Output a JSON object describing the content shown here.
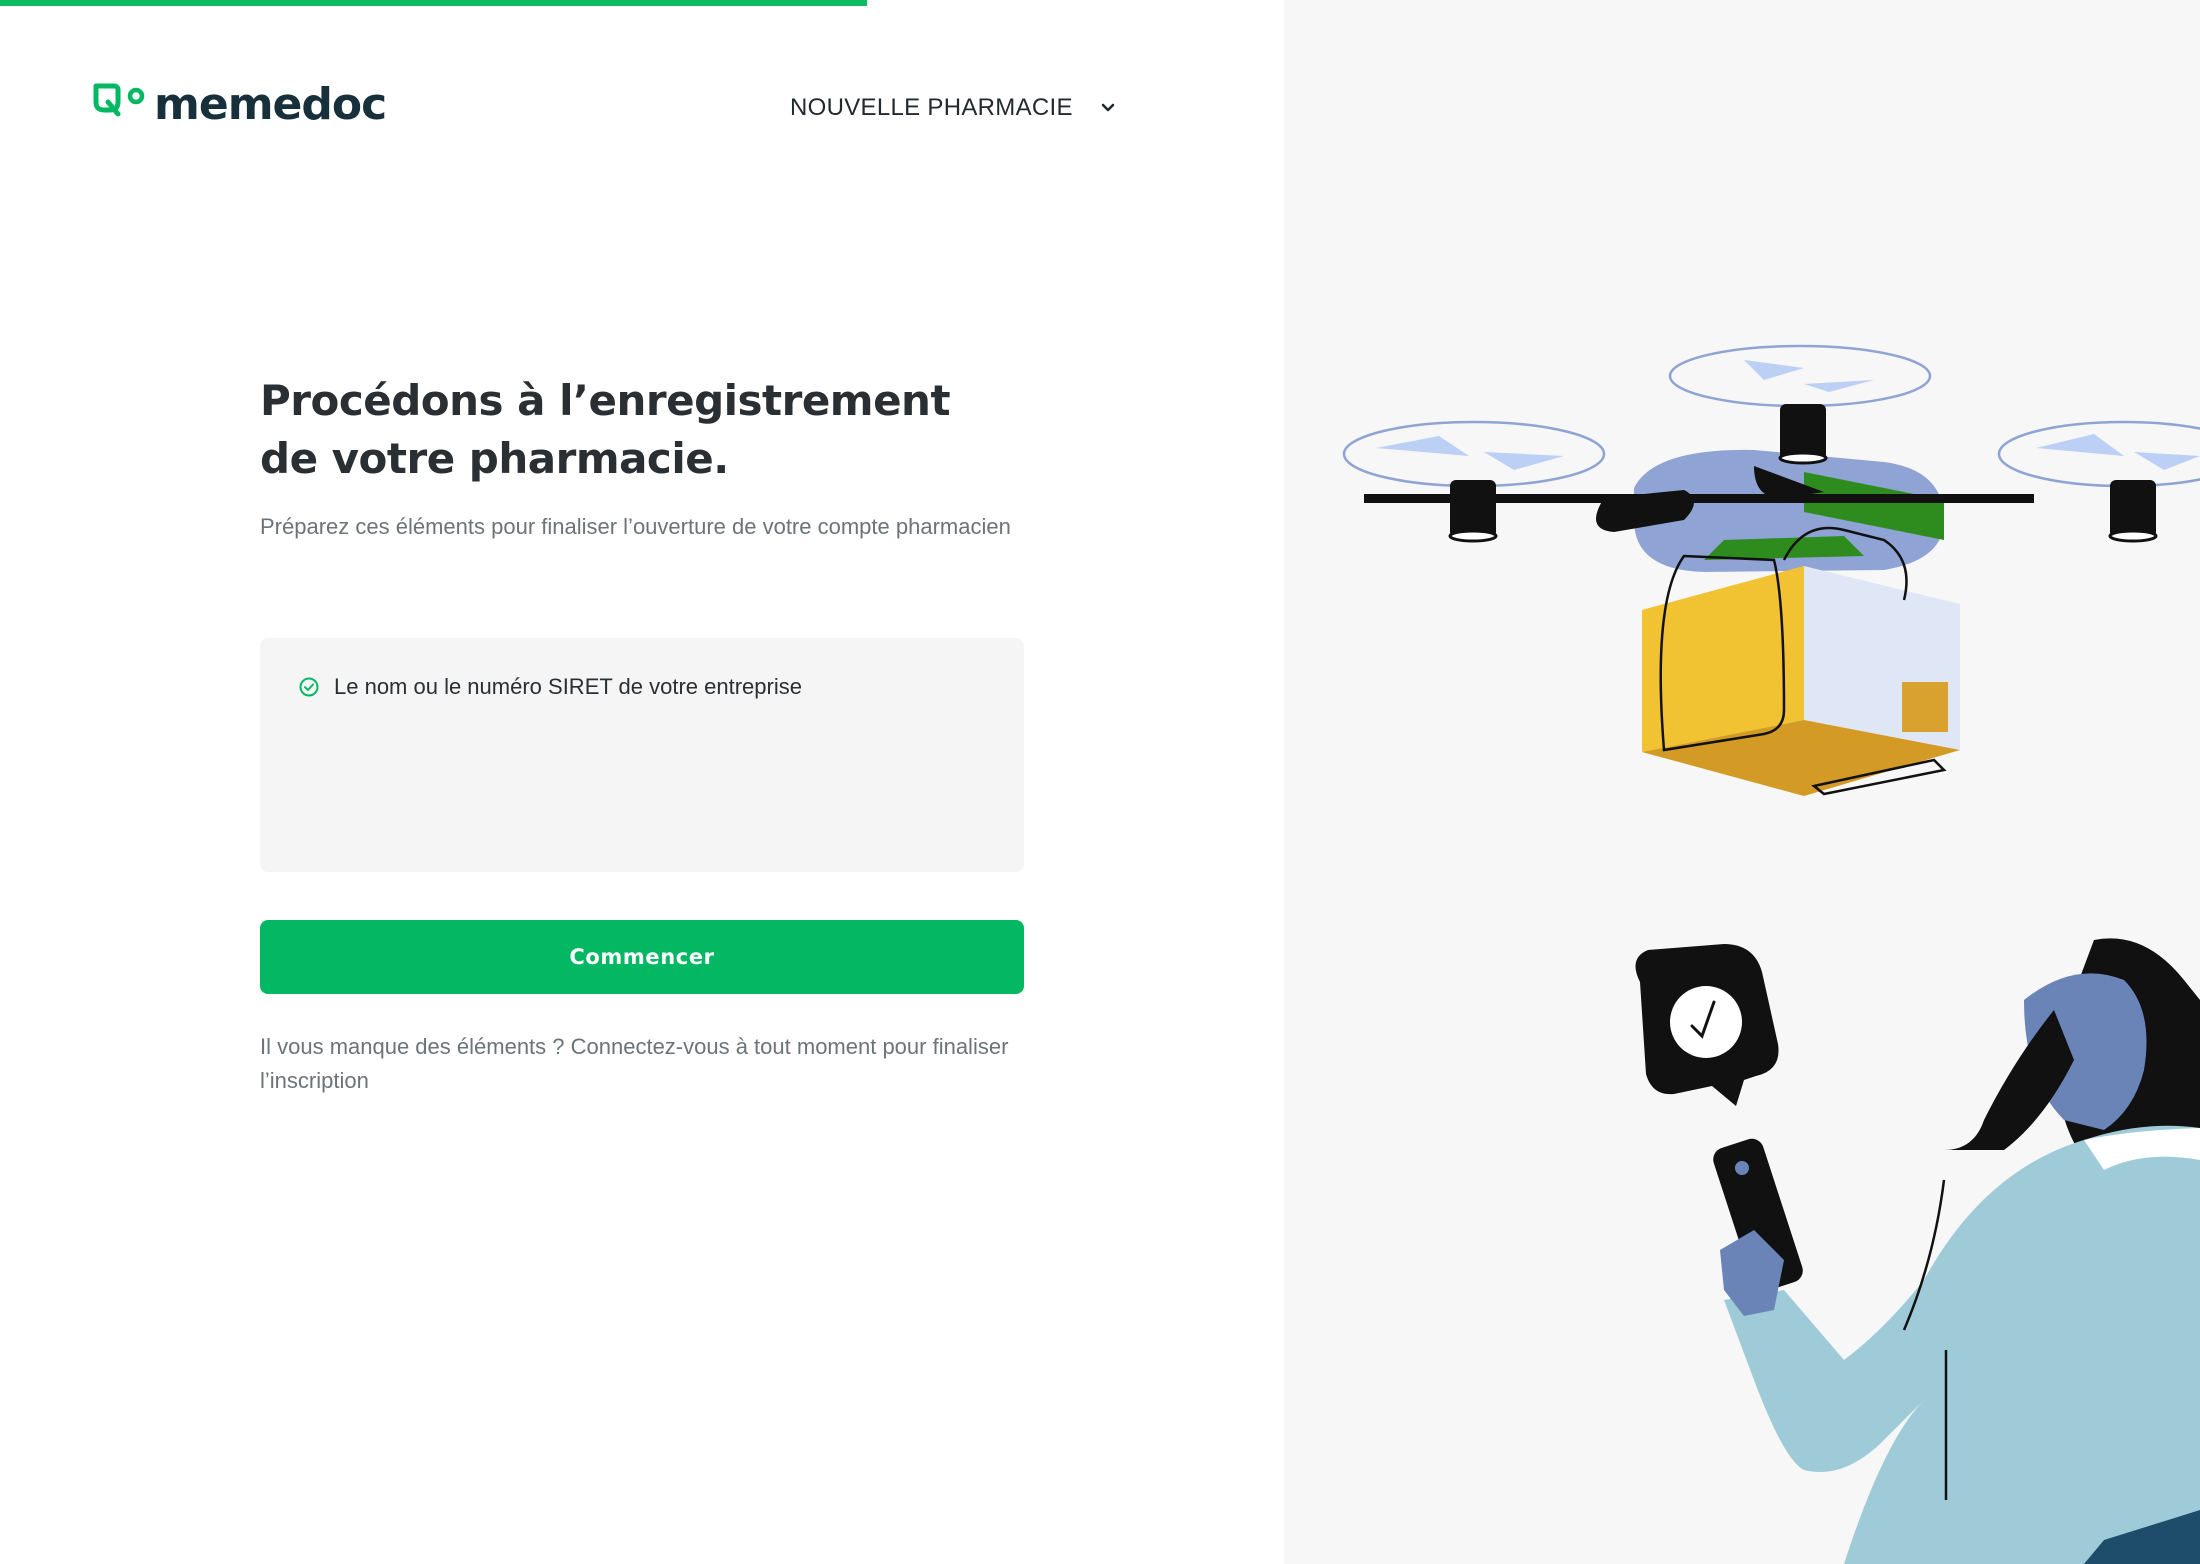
{
  "progress": {
    "fraction": 0.394
  },
  "brand": {
    "name": "memedoc",
    "color": "#04b863",
    "text_color": "#17303b"
  },
  "header": {
    "pharmacy_selector": {
      "label": "NOUVELLE PHARMACIE",
      "icon": "chevron-down-icon"
    }
  },
  "onboarding": {
    "title_line1": "Procédons à l’enregistrement",
    "title_line2": "de votre pharmacie.",
    "subtitle": "Préparez ces éléments pour finaliser l’ouverture de votre compte pharmacien",
    "checklist": [
      {
        "label": "Le nom ou le numéro SIRET de votre entreprise",
        "icon": "check-circle-icon",
        "checked": true
      }
    ],
    "start_button": "Commencer",
    "footnote": "Il vous manque des éléments ? Connectez-vous à tout moment pour finaliser l’inscription"
  },
  "illustration": {
    "subject": "drone-delivery-illustration",
    "colors": {
      "background": "#f6f7f6",
      "box_yellow": "#f1c232",
      "drone_blue": "#8fa3d4",
      "accent_green": "#2e8b1e",
      "sweater": "#9fcbd9"
    }
  }
}
